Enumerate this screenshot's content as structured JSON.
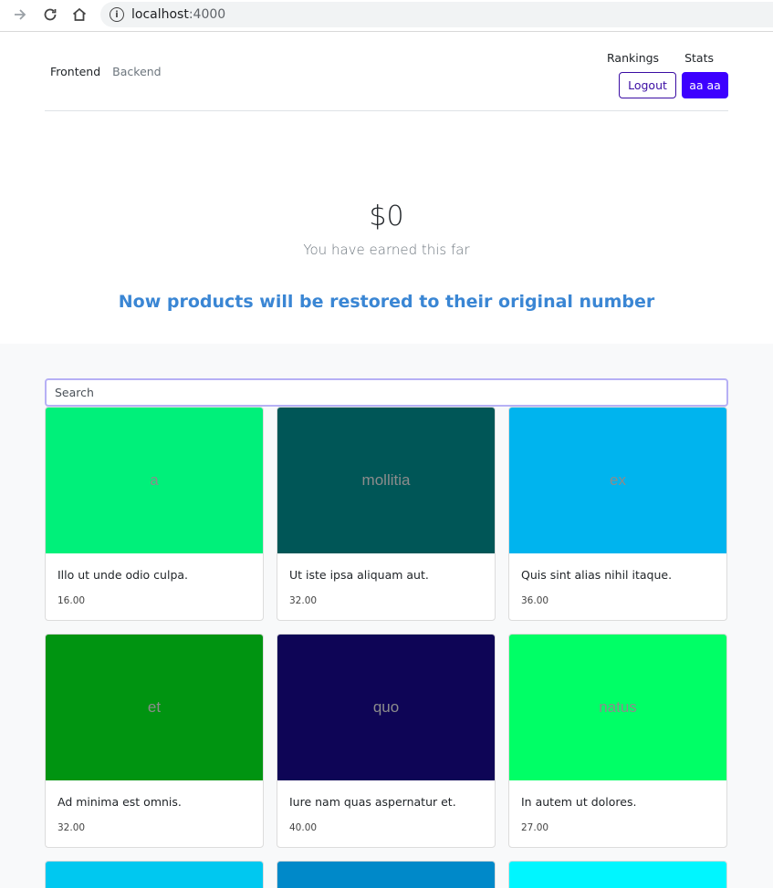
{
  "browser": {
    "url_host": "localhost",
    "url_port": ":4000"
  },
  "header": {
    "nav_left": [
      "Frontend",
      "Backend"
    ],
    "nav_right": [
      "Rankings",
      "Stats"
    ],
    "logout_label": "Logout",
    "user_label": "aa aa"
  },
  "hero": {
    "amount": "$0",
    "subtitle": "You have earned this far",
    "notice": "Now products will be restored to their original number"
  },
  "search": {
    "placeholder": "Search"
  },
  "products": [
    {
      "image_text": "a",
      "color": "#00f07a",
      "title": "Illo ut unde odio culpa.",
      "price": "16.00"
    },
    {
      "image_text": "mollitia",
      "color": "#005657",
      "title": "Ut iste ipsa aliquam aut.",
      "price": "32.00"
    },
    {
      "image_text": "ex",
      "color": "#00b4ee",
      "title": "Quis sint alias nihil itaque.",
      "price": "36.00"
    },
    {
      "image_text": "et",
      "color": "#009411",
      "title": "Ad minima est omnis.",
      "price": "32.00"
    },
    {
      "image_text": "quo",
      "color": "#0e0556",
      "title": "Iure nam quas aspernatur et.",
      "price": "40.00"
    },
    {
      "image_text": "natus",
      "color": "#00ff66",
      "title": "In autem ut dolores.",
      "price": "27.00"
    },
    {
      "image_text": "",
      "color": "#00c8f0",
      "title": "",
      "price": ""
    },
    {
      "image_text": "",
      "color": "#0089c9",
      "title": "",
      "price": ""
    },
    {
      "image_text": "",
      "color": "#00f6ff",
      "title": "",
      "price": ""
    }
  ]
}
